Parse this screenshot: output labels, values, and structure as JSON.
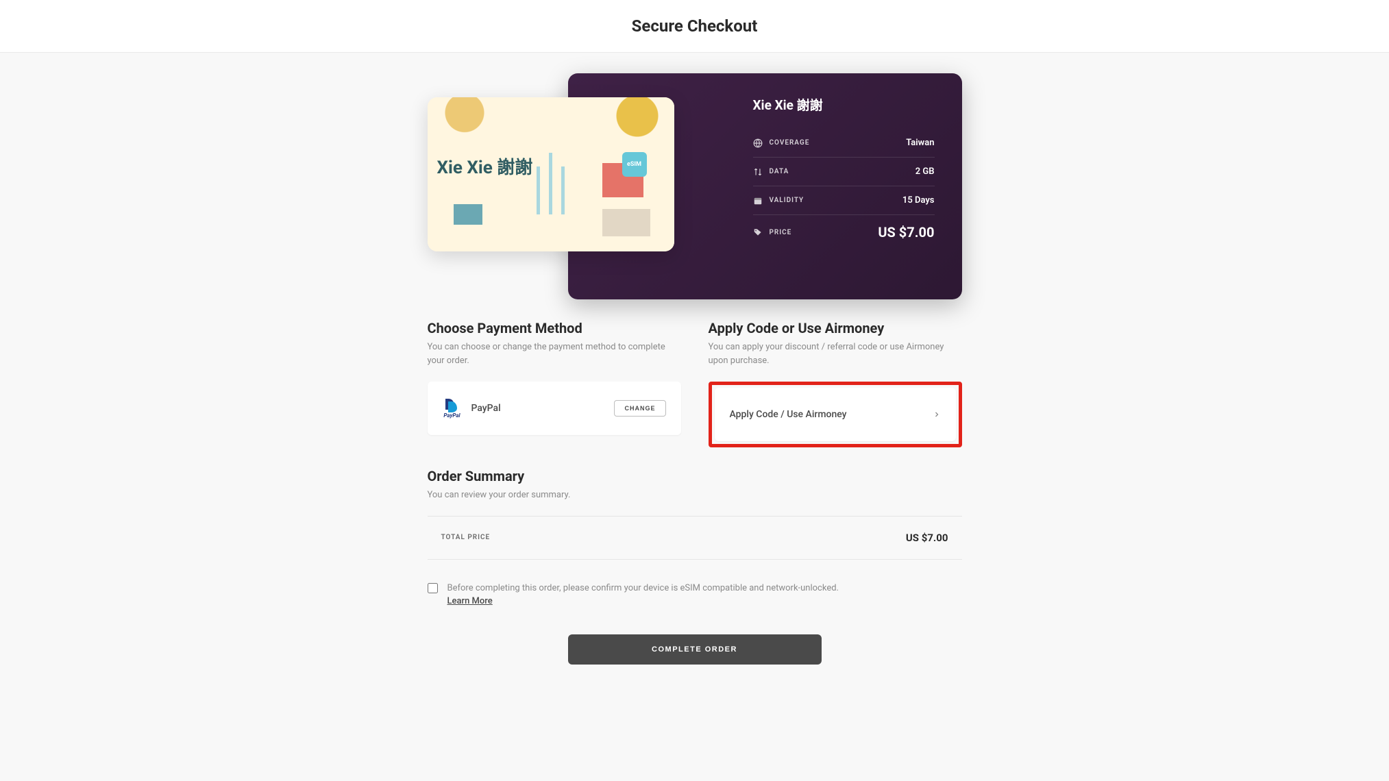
{
  "header": {
    "title": "Secure Checkout"
  },
  "product": {
    "name": "Xie Xie 謝謝",
    "image_text": "Xie Xie 謝謝",
    "esim_badge": "eSIM",
    "rows": [
      {
        "label": "COVERAGE",
        "value": "Taiwan",
        "icon": "globe"
      },
      {
        "label": "DATA",
        "value": "2 GB",
        "icon": "arrows"
      },
      {
        "label": "VALIDITY",
        "value": "15 Days",
        "icon": "calendar"
      },
      {
        "label": "PRICE",
        "value": "US $7.00",
        "icon": "tag",
        "is_price": true
      }
    ]
  },
  "payment": {
    "title": "Choose Payment Method",
    "desc": "You can choose or change the payment method to complete your order.",
    "method_name": "PayPal",
    "change_label": "CHANGE"
  },
  "apply_code": {
    "title": "Apply Code or Use Airmoney",
    "desc": "You can apply your discount / referral code or use Airmoney upon purchase.",
    "button_label": "Apply Code / Use Airmoney"
  },
  "order_summary": {
    "title": "Order Summary",
    "desc": "You can review your order summary.",
    "total_label": "TOTAL PRICE",
    "total_value": "US $7.00"
  },
  "confirm": {
    "text": "Before completing this order, please confirm your device is eSIM compatible and network-unlocked.",
    "learn_more": "Learn More"
  },
  "complete_label": "COMPLETE ORDER"
}
